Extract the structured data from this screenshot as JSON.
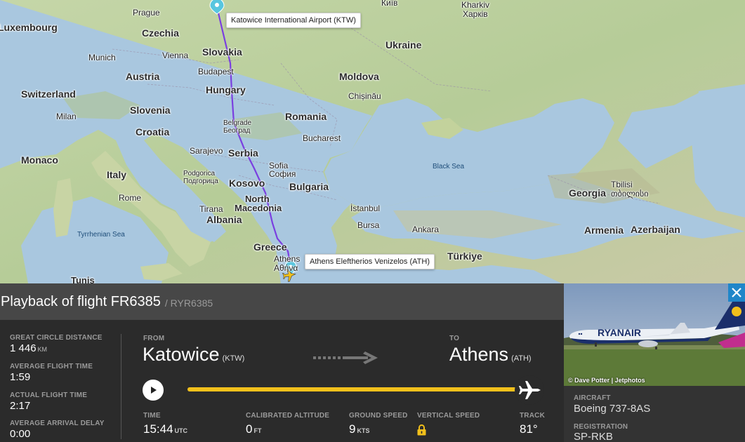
{
  "map": {
    "countries": [
      {
        "name": "Czechia"
      },
      {
        "name": "Slovakia"
      },
      {
        "name": "Austria"
      },
      {
        "name": "Hungary"
      },
      {
        "name": "Switzerland"
      },
      {
        "name": "Slovenia"
      },
      {
        "name": "Croatia"
      },
      {
        "name": "Italy"
      },
      {
        "name": "Monaco"
      },
      {
        "name": "Serbia"
      },
      {
        "name": "Kosovo"
      },
      {
        "name": "Bulgaria"
      },
      {
        "name": "Romania"
      },
      {
        "name": "Moldova"
      },
      {
        "name": "Ukraine"
      },
      {
        "name": "Albania"
      },
      {
        "name": "Greece"
      },
      {
        "name": "Türkiye"
      },
      {
        "name": "Georgia"
      },
      {
        "name": "Armenia"
      },
      {
        "name": "Azerbaijan"
      },
      {
        "name": "Luxembourg"
      }
    ],
    "cities": [
      {
        "name": "Prague"
      },
      {
        "name": "Munich"
      },
      {
        "name": "Vienna"
      },
      {
        "name": "Budapest"
      },
      {
        "name": "Milan"
      },
      {
        "name": "Rome"
      },
      {
        "name": "Sarajevo"
      },
      {
        "name": "Belgrade"
      },
      {
        "name": "Београд"
      },
      {
        "name": "Sofia"
      },
      {
        "name": "София"
      },
      {
        "name": "Podgorica"
      },
      {
        "name": "Подгорица"
      },
      {
        "name": "Tirana"
      },
      {
        "name": "North"
      },
      {
        "name": "Macedonia"
      },
      {
        "name": "Bucharest"
      },
      {
        "name": "Chișinău"
      },
      {
        "name": "İstanbul"
      },
      {
        "name": "Bursa"
      },
      {
        "name": "Ankara"
      },
      {
        "name": "Athens"
      },
      {
        "name": "Αθήνα"
      },
      {
        "name": "Tbilisi"
      },
      {
        "name": "თბილისი"
      },
      {
        "name": "Київ"
      },
      {
        "name": "Kharkiv"
      },
      {
        "name": "Харків"
      },
      {
        "name": "Tunis"
      }
    ],
    "water": [
      {
        "name": "Black Sea"
      },
      {
        "name": "Tyrrhenian Sea"
      }
    ],
    "origin_tooltip": "Katowice International Airport (KTW)",
    "destination_tooltip": "Athens Eleftherios Venizelos (ATH)",
    "colors": {
      "route": "#7a3fe0",
      "land": "#b8cf9c",
      "sea": "#a9c7df"
    }
  },
  "panel": {
    "title": "Playback of flight FR6385",
    "callsign": "/ RYR6385",
    "stats": [
      {
        "label": "GREAT CIRCLE DISTANCE",
        "value": "1 446",
        "unit": "KM"
      },
      {
        "label": "AVERAGE FLIGHT TIME",
        "value": "1:59",
        "unit": ""
      },
      {
        "label": "ACTUAL FLIGHT TIME",
        "value": "2:17",
        "unit": ""
      },
      {
        "label": "AVERAGE ARRIVAL DELAY",
        "value": "0:00",
        "unit": ""
      }
    ],
    "from": {
      "label": "FROM",
      "city": "Katowice",
      "code": "(KTW)"
    },
    "to": {
      "label": "TO",
      "city": "Athens",
      "code": "(ATH)"
    },
    "playback_progress": 1.0,
    "live": [
      {
        "label": "TIME",
        "value": "15:44",
        "unit": "UTC"
      },
      {
        "label": "CALIBRATED ALTITUDE",
        "value": "0",
        "unit": "FT"
      },
      {
        "label": "GROUND SPEED",
        "value": "9",
        "unit": "KTS"
      },
      {
        "label": "VERTICAL SPEED",
        "value": "",
        "unit": "",
        "icon": "lock-icon"
      },
      {
        "label": "TRACK",
        "value": "81°",
        "unit": ""
      }
    ],
    "colors": {
      "progress": "#f2c01b",
      "accent": "#1f86c9"
    }
  },
  "photo": {
    "credit": "© Dave Potter | Jetphotos",
    "livery_text": "RYANAIR"
  },
  "aircraft": {
    "aircraft_label": "AIRCRAFT",
    "aircraft_value": "Boeing 737-8AS",
    "registration_label": "REGISTRATION",
    "registration_value": "SP-RKB"
  }
}
